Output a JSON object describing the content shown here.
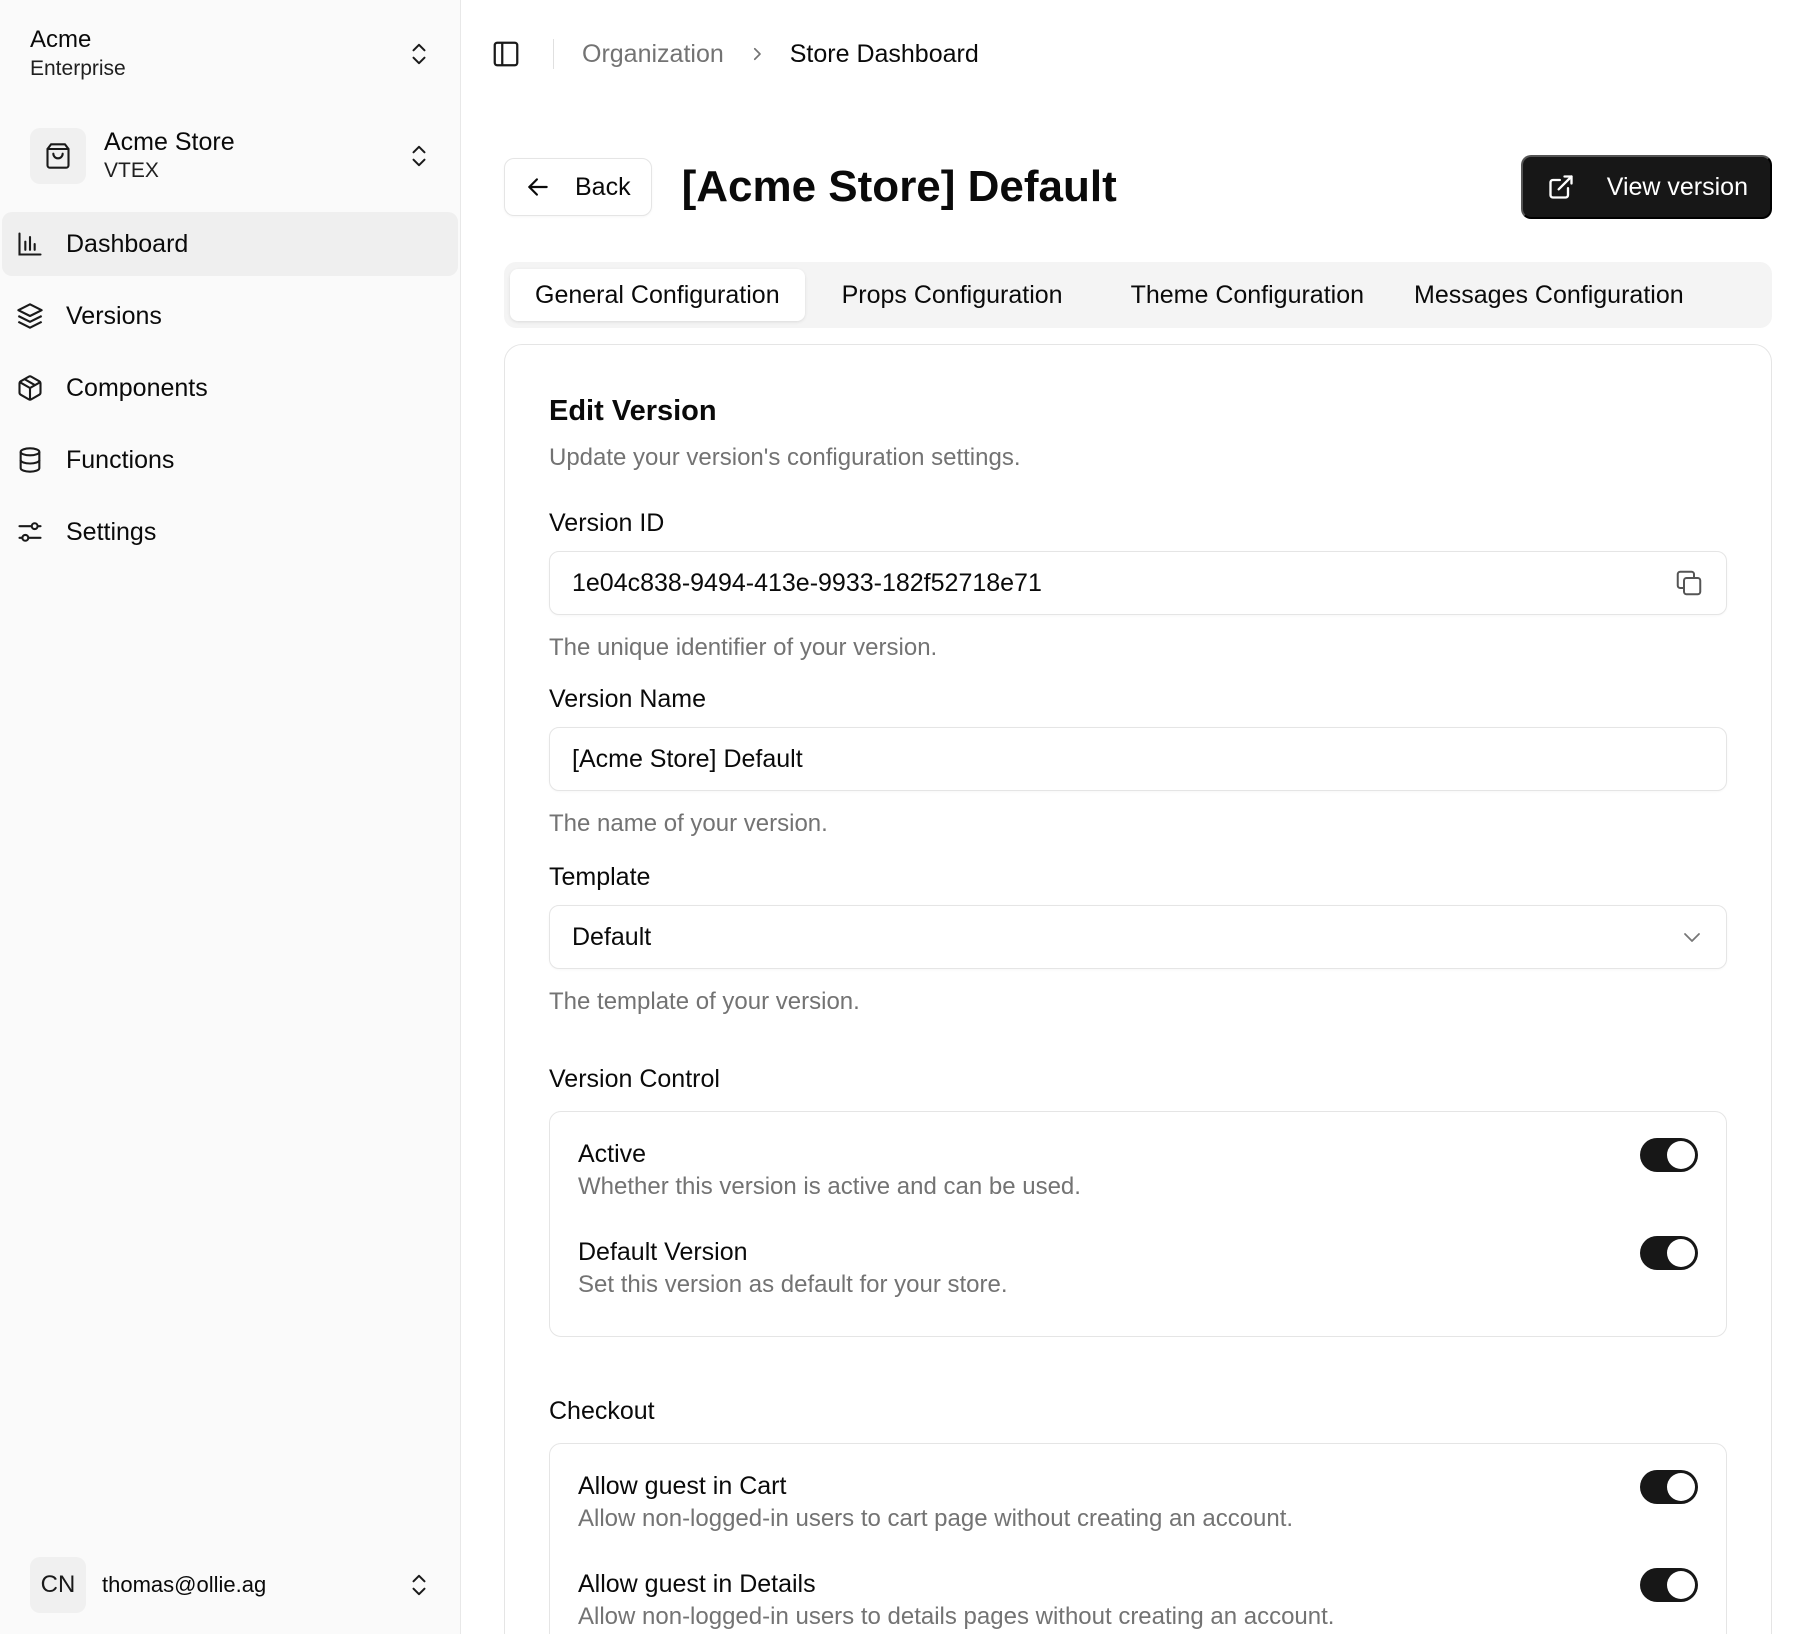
{
  "sidebar": {
    "org": {
      "name": "Acme",
      "plan": "Enterprise"
    },
    "store": {
      "name": "Acme Store",
      "platform": "VTEX"
    },
    "nav": [
      {
        "label": "Dashboard",
        "icon": "bar-chart-icon",
        "active": true
      },
      {
        "label": "Versions",
        "icon": "layers-icon"
      },
      {
        "label": "Components",
        "icon": "box-icon"
      },
      {
        "label": "Functions",
        "icon": "database-icon"
      },
      {
        "label": "Settings",
        "icon": "sliders-icon"
      }
    ],
    "user": {
      "initials": "CN",
      "email": "thomas@ollie.ag"
    }
  },
  "breadcrumb": {
    "parent": "Organization",
    "current": "Store Dashboard"
  },
  "header": {
    "back_label": "Back",
    "title": "[Acme Store] Default",
    "view_label": "View version"
  },
  "tabs": [
    {
      "label": "General Configuration",
      "active": true
    },
    {
      "label": "Props Configuration"
    },
    {
      "label": "Theme Configuration"
    },
    {
      "label": "Messages Configuration"
    }
  ],
  "form": {
    "title": "Edit Version",
    "description": "Update your version's configuration settings.",
    "version_id": {
      "label": "Version ID",
      "value": "1e04c838-9494-413e-9933-182f52718e71",
      "help": "The unique identifier of your version."
    },
    "version_name": {
      "label": "Version Name",
      "value": "[Acme Store] Default",
      "help": "The name of your version."
    },
    "template": {
      "label": "Template",
      "value": "Default",
      "help": "The template of your version."
    },
    "version_control": {
      "title": "Version Control",
      "toggles": [
        {
          "title": "Active",
          "desc": "Whether this version is active and can be used.",
          "on": true
        },
        {
          "title": "Default Version",
          "desc": "Set this version as default for your store.",
          "on": true
        }
      ]
    },
    "checkout": {
      "title": "Checkout",
      "toggles": [
        {
          "title": "Allow guest in Cart",
          "desc": "Allow non-logged-in users to cart page without creating an account.",
          "on": true
        },
        {
          "title": "Allow guest in Details",
          "desc": "Allow non-logged-in users to details pages without creating an account.",
          "on": true
        }
      ]
    }
  }
}
